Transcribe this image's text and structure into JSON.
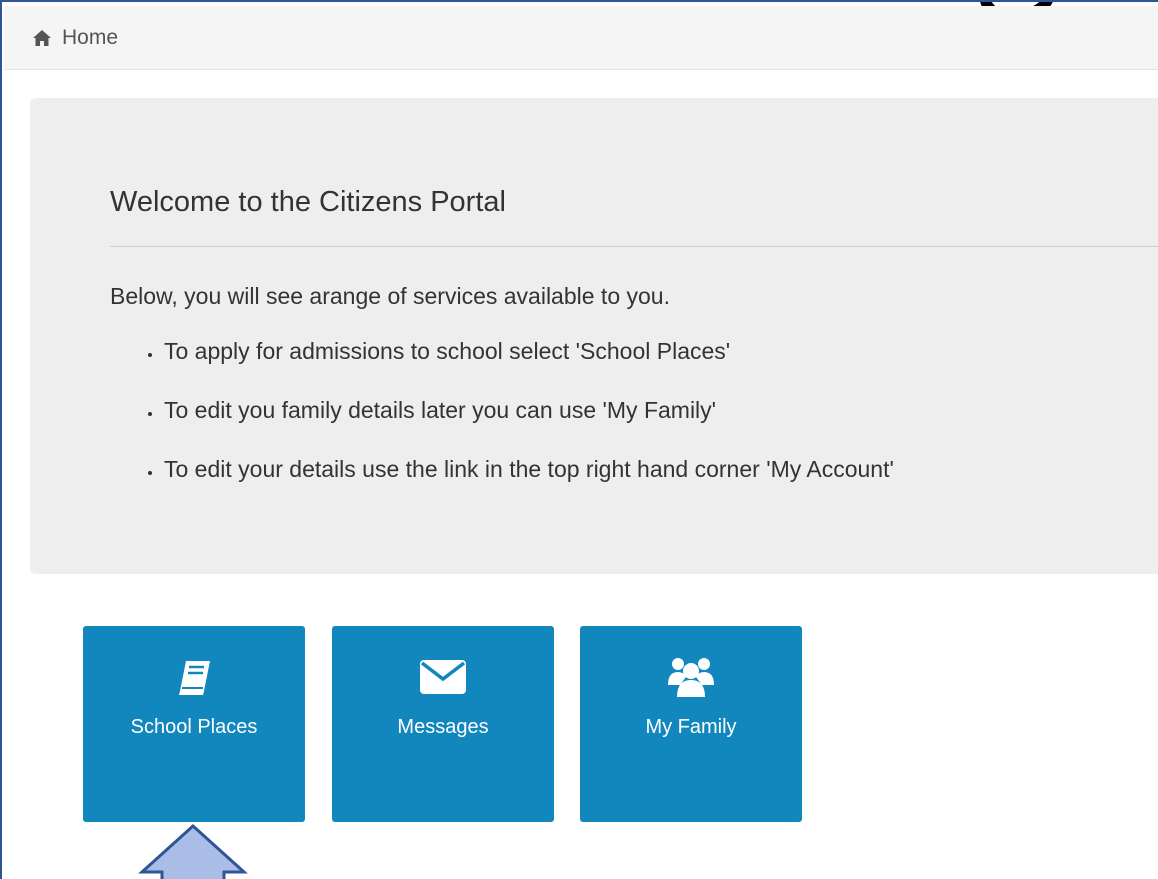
{
  "breadcrumb": {
    "home_label": "Home",
    "home_icon": "home-icon"
  },
  "welcome": {
    "title": "Welcome to the Citizens Portal",
    "intro": "Below, you will see arange of services available to you.",
    "bullets": [
      "To apply for admissions to school select 'School Places'",
      "To edit you family details later you can use 'My Family'",
      "To edit your details use the link in the top right hand corner 'My Account'"
    ]
  },
  "tiles": [
    {
      "label": "School Places",
      "icon": "book-icon"
    },
    {
      "label": "Messages",
      "icon": "envelope-icon"
    },
    {
      "label": "My Family",
      "icon": "users-icon"
    }
  ],
  "colors": {
    "tile_bg": "#1287bd",
    "jumbotron_bg": "#eeeeee",
    "frame_border": "#2f5597",
    "arrow_fill": "#a9bde6"
  }
}
